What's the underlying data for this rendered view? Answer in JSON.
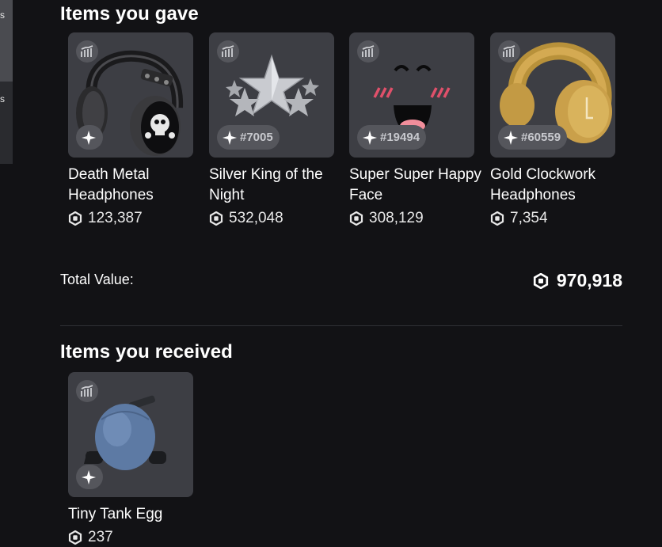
{
  "sidebar": {
    "items": [
      {
        "label": "s"
      },
      {
        "label": "s"
      }
    ]
  },
  "gave": {
    "title": "Items you gave",
    "items": [
      {
        "name": "Death Metal Headphones",
        "price": "123,387",
        "serial": "",
        "icon": "headphones-skull"
      },
      {
        "name": "Silver King of the Night",
        "price": "532,048",
        "serial": "#7005",
        "icon": "star-crown"
      },
      {
        "name": "Super Super Happy Face",
        "price": "308,129",
        "serial": "#19494",
        "icon": "happy-face"
      },
      {
        "name": "Gold Clockwork Headphones",
        "price": "7,354",
        "serial": "#60559",
        "icon": "gold-headphones"
      }
    ]
  },
  "total": {
    "label": "Total Value:",
    "value": "970,918"
  },
  "received": {
    "title": "Items you received",
    "items": [
      {
        "name": "Tiny Tank Egg",
        "price": "237",
        "serial": "",
        "icon": "tank-egg"
      }
    ]
  },
  "colors": {
    "background": "#121215",
    "card": "#3d3e44",
    "badge": "#55565c",
    "text": "#ffffff"
  }
}
